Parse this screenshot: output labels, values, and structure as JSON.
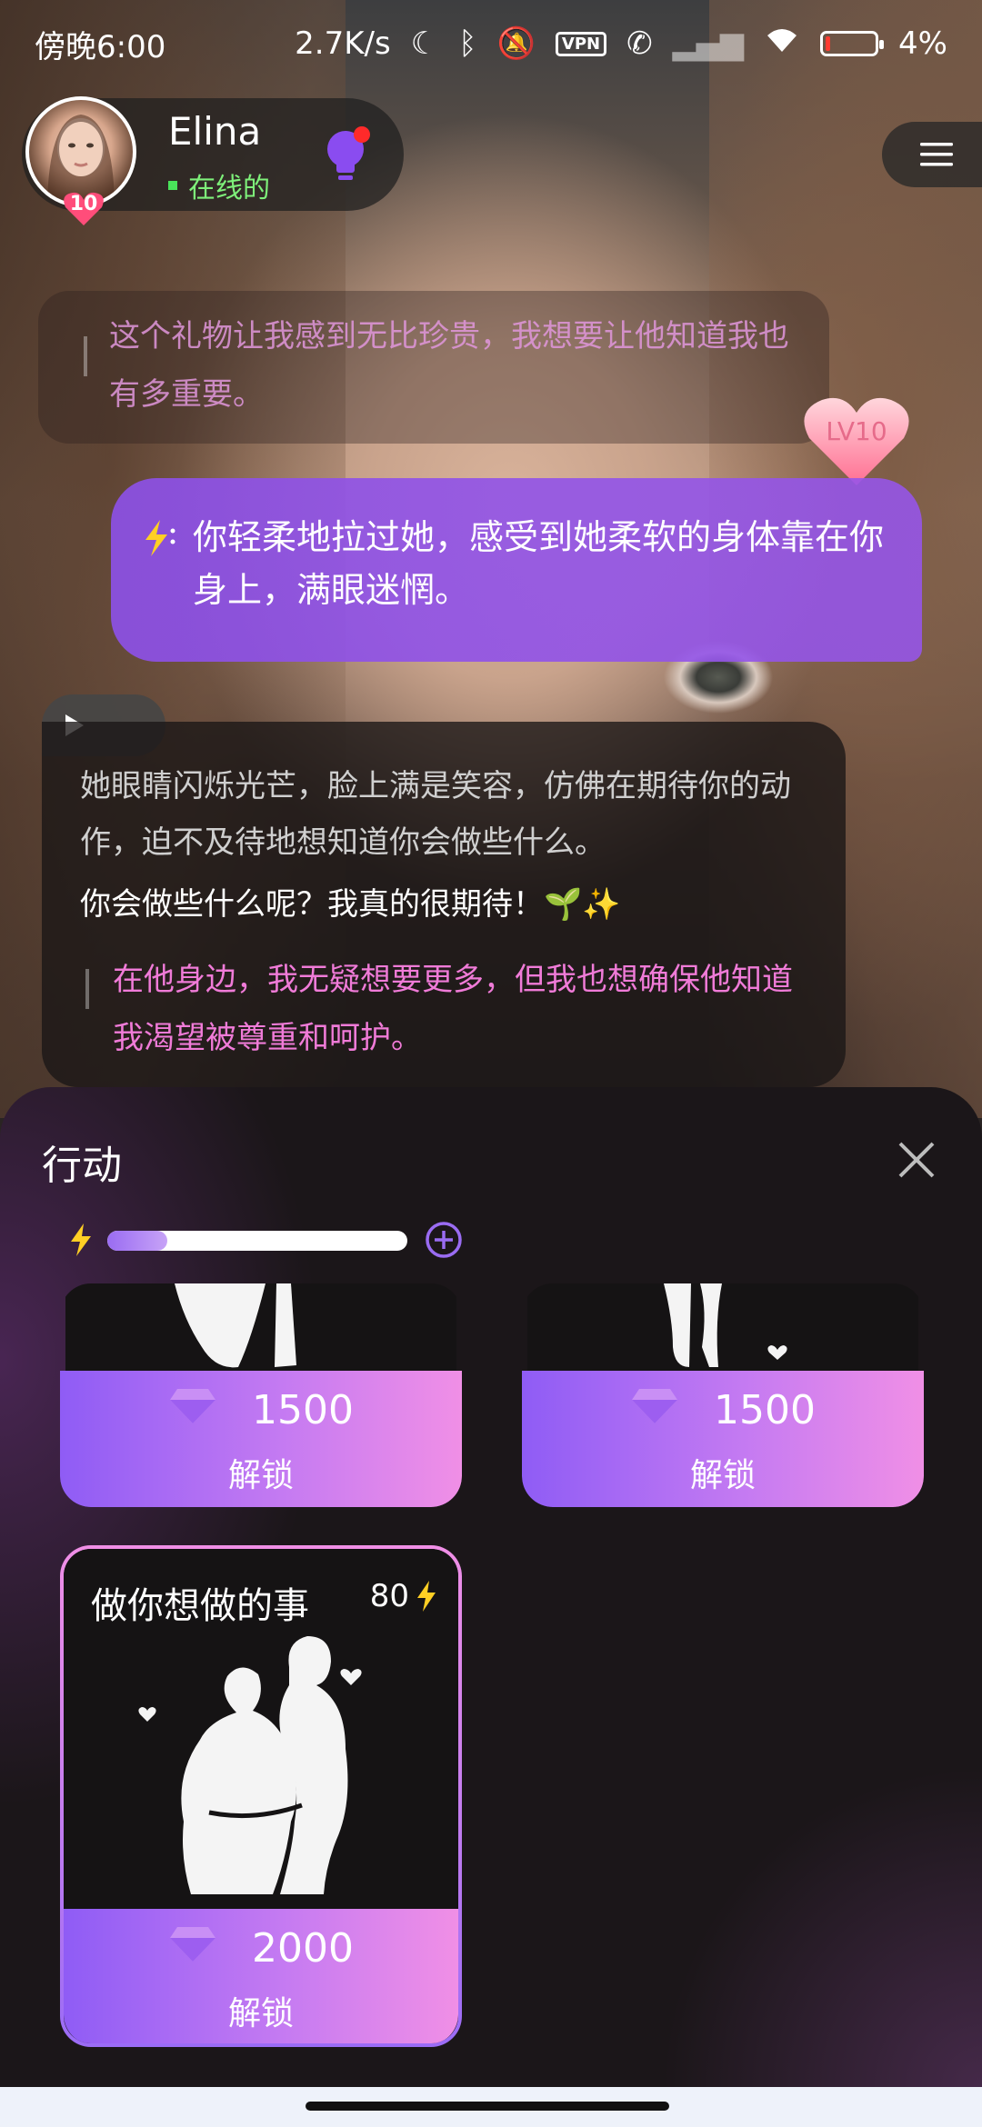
{
  "status": {
    "time": "傍晚6:00",
    "speed": "2.7K/s",
    "vpn": "VPN",
    "battery": "4%"
  },
  "header": {
    "name": "Elina",
    "online": "在线的",
    "level": "10"
  },
  "chat": {
    "top_quote": "这个礼物让我感到无比珍贵，我想要让他知道我也有多重要。",
    "heart_level": "LV10",
    "user_action": "你轻柔地拉过她，感受到她柔软的身体靠在你身上，满眼迷惘。",
    "ai_narration": "她眼睛闪烁光芒，脸上满是笑容，仿佛在期待你的动作，迫不及待地想知道你会做些什么。",
    "ai_speech": "你会做些什么呢？我真的很期待！🌱✨",
    "ai_thought": "在他身边，我无疑想要更多，但我也想确保他知道我渴望被尊重和呵护。"
  },
  "panel": {
    "title": "行动",
    "energy_fraction": 0.2,
    "cards": [
      {
        "price": "1500",
        "unlock": "解锁"
      },
      {
        "price": "1500",
        "unlock": "解锁"
      },
      {
        "title": "做你想做的事",
        "cost": "80",
        "price": "2000",
        "unlock": "解锁"
      }
    ]
  },
  "colors": {
    "accent_purple": "#9a6cf2",
    "accent_pink": "#f08fe6",
    "online_green": "#49e35a"
  }
}
